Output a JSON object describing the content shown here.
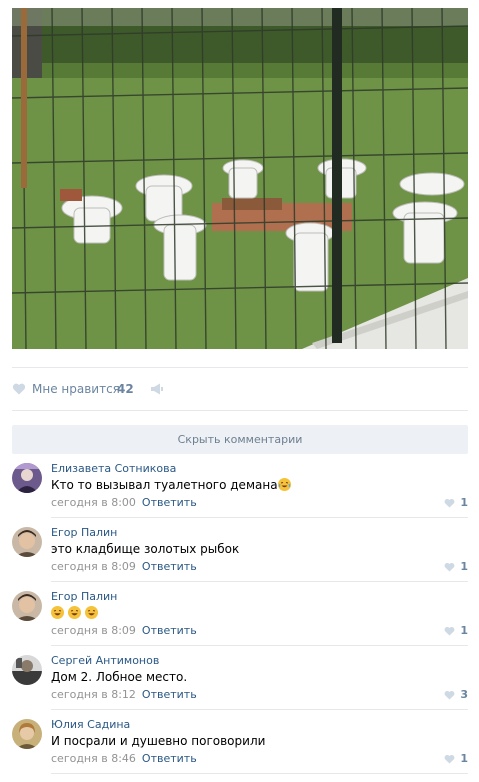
{
  "post": {
    "photo_alt": "toilets behind fence",
    "watermark": "",
    "likes_label": "Мне нравится",
    "likes_count": "42",
    "hide_comments_label": "Скрыть комментарии"
  },
  "comments": [
    {
      "author": "Елизавета Сотникова",
      "text": "Кто то вызывал туалетного демана",
      "emoji": "laughing-tears-emoji",
      "time": "сегодня в 8:00",
      "reply": "Ответить",
      "likes": "1"
    },
    {
      "author": "Егор Палин",
      "text": "это кладбище золотых рыбок",
      "time": "сегодня в 8:09",
      "reply": "Ответить",
      "likes": "1"
    },
    {
      "author": "Егор Палин",
      "text": "",
      "emoji_row": [
        "grin-emoji",
        "grin-emoji",
        "grin-emoji"
      ],
      "time": "сегодня в 8:09",
      "reply": "Ответить",
      "likes": "1"
    },
    {
      "author": "Сергей Антимонов",
      "text": "Дом 2. Лобное место.",
      "time": "сегодня в 8:12",
      "reply": "Ответить",
      "likes": "3"
    },
    {
      "author": "Юлия Садина",
      "text": "И посрали и душевно поговорили",
      "time": "сегодня в 8:46",
      "reply": "Ответить",
      "likes": "1"
    }
  ],
  "colors": {
    "link": "#2a5885",
    "meta": "#939393",
    "like": "#6b85a0",
    "button_bg": "#edf0f4"
  }
}
